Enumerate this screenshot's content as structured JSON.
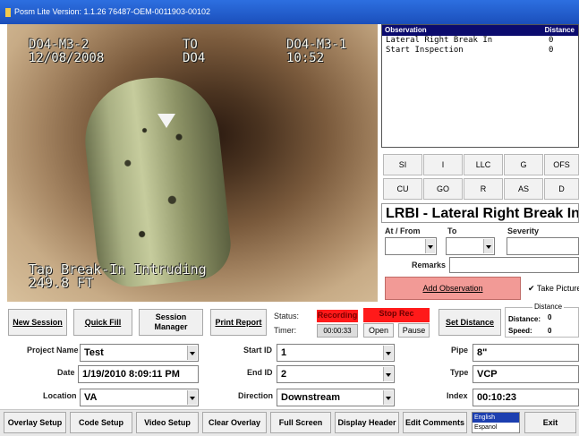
{
  "window": {
    "title": "Posm Lite Version: 1.1.26 76487-OEM-0011903-00102"
  },
  "video": {
    "top_left_line1": "DO4-M3-2",
    "top_left_line2": "12/08/2008",
    "top_center_line1": "TO",
    "top_center_line2": "DO4",
    "top_right_line1": "DO4-M3-1",
    "top_right_line2": "10:52",
    "bottom_line1": "Tap Break-In Intruding",
    "bottom_line2": "249.8 FT"
  },
  "observations": {
    "header_observation": "Observation",
    "header_distance": "Distance",
    "rows": [
      {
        "text": "Lateral Right Break In",
        "distance": "0"
      },
      {
        "text": "Start Inspection",
        "distance": "0"
      }
    ]
  },
  "codes": [
    "SI",
    "I",
    "LLC",
    "G",
    "OFS",
    "CU",
    "GO",
    "R",
    "AS",
    "D"
  ],
  "observation_entry": {
    "name": "LRBI - Lateral Right Break In",
    "at_from_label": "At / From",
    "to_label": "To",
    "severity_label": "Severity",
    "remarks_label": "Remarks",
    "add_button": "Add Observation",
    "take_picture_label": "Take Picture"
  },
  "controls": {
    "new_session": "New Session",
    "quick_fill": "Quick Fill",
    "session_manager": "Session Manager",
    "print_report": "Print Report",
    "status_label": "Status:",
    "status_value": "Recording",
    "stop_rec": "Stop Rec",
    "timer_label": "Timer:",
    "timer_value": "00:00:33",
    "open": "Open",
    "pause": "Pause",
    "set_distance": "Set Distance",
    "distance_group": "Distance",
    "distance_label": "Distance:",
    "distance_value": "0",
    "speed_label": "Speed:",
    "speed_value": "0"
  },
  "form": {
    "project_name_label": "Project Name",
    "project_name": "Test",
    "date_label": "Date",
    "date": "1/19/2010 8:09:11 PM",
    "location_label": "Location",
    "location": "VA",
    "start_id_label": "Start ID",
    "start_id": "1",
    "end_id_label": "End ID",
    "end_id": "2",
    "direction_label": "Direction",
    "direction": "Downstream",
    "pipe_label": "Pipe",
    "pipe": "8\"",
    "type_label": "Type",
    "type": "VCP",
    "index_label": "Index",
    "index": "00:10:23"
  },
  "bottom": {
    "overlay_setup": "Overlay Setup",
    "code_setup": "Code Setup",
    "video_setup": "Video Setup",
    "clear_overlay": "Clear Overlay",
    "full_screen": "Full Screen",
    "display_header": "Display Header",
    "edit_comments": "Edit Comments",
    "languages": [
      "English",
      "Espanol"
    ],
    "exit": "Exit"
  },
  "colors": {
    "title_bar": "#1b4fbb",
    "recording": "#ff1a1a",
    "add_observation": "#f29a96",
    "observation_header": "#0b0b6e"
  }
}
